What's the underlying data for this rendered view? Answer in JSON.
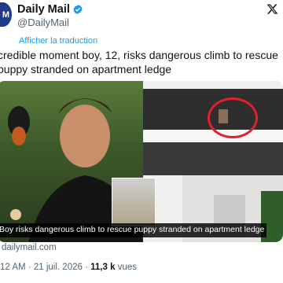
{
  "account": {
    "name": "Daily Mail",
    "handle": "@DailyMail",
    "avatar_text": "M"
  },
  "translate_label": "Afficher la traduction",
  "tweet_text": "credible moment boy, 12, risks dangerous climb to rescue puppy stranded on apartment ledge",
  "media": {
    "caption": "Boy risks dangerous climb to rescue puppy stranded on apartment ledge"
  },
  "link_source": "dailymail.com",
  "meta": {
    "time": "12 AM",
    "sep1": "·",
    "date": "21 juil. 2026",
    "sep2": "·",
    "views_count": "11,3 k",
    "views_label": "vues"
  },
  "icons": {
    "platform": "x-logo-icon",
    "verified": "verified-badge-icon"
  },
  "colors": {
    "link": "#1d9bf0",
    "muted": "#536471",
    "verified": "#1d9bf0",
    "annotation": "#e0212a"
  }
}
